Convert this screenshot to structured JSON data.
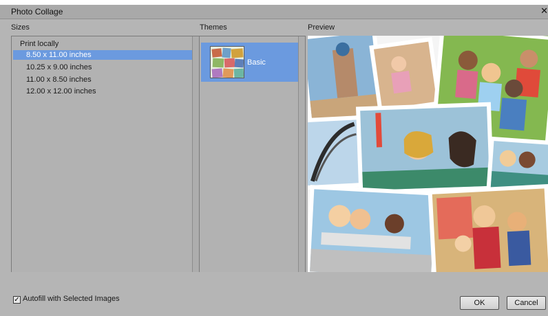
{
  "window": {
    "title": "Photo Collage",
    "close_glyph": "✕"
  },
  "labels": {
    "sizes": "Sizes",
    "themes": "Themes",
    "preview": "Preview"
  },
  "sizes": {
    "root": "Print locally",
    "items": [
      {
        "label": "8.50 x 11.00 inches",
        "selected": true
      },
      {
        "label": "10.25 x 9.00 inches",
        "selected": false
      },
      {
        "label": "11.00 x 8.50 inches",
        "selected": false
      },
      {
        "label": "12.00 x 12.00 inches",
        "selected": false
      }
    ]
  },
  "themes": {
    "items": [
      {
        "label": "Basic",
        "selected": true
      }
    ]
  },
  "footer": {
    "autofill_label": "Autofill with Selected Images",
    "autofill_checked": true,
    "ok_label": "OK",
    "cancel_label": "Cancel"
  },
  "colors": {
    "selection": "#6b9adf",
    "dialog_bg": "#b5b5b5"
  },
  "icons": {
    "checkbox": "checkmark-icon"
  }
}
